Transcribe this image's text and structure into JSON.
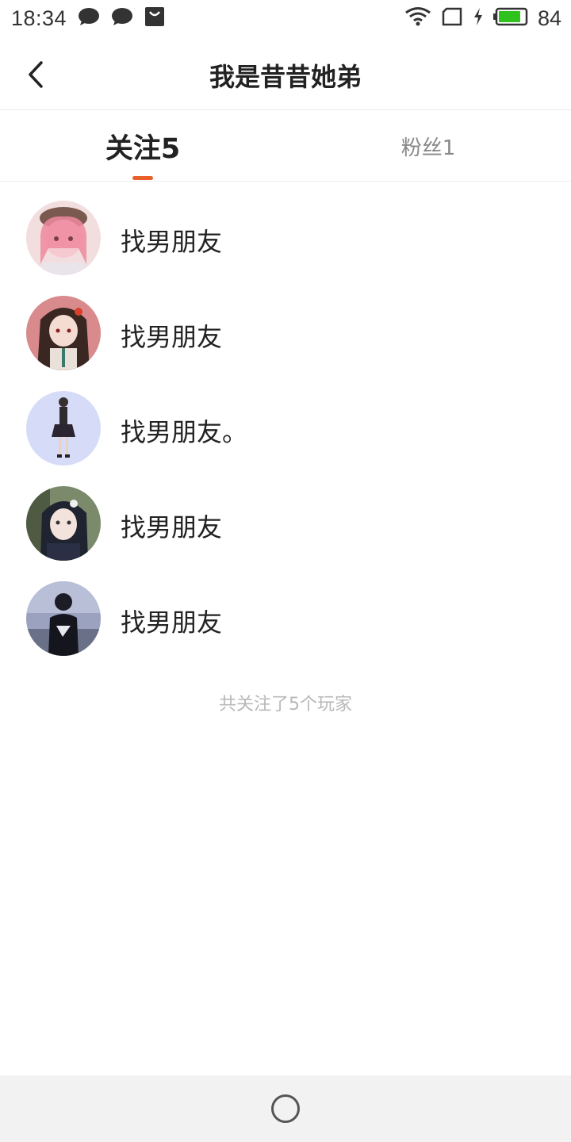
{
  "status_bar": {
    "time": "18:34",
    "battery": "84",
    "icons": [
      "chat-bubble-icon",
      "chat-bubble-icon",
      "shopping-bag-icon",
      "wifi-icon",
      "sim-card-icon",
      "charging-bolt-icon",
      "battery-icon"
    ],
    "battery_level": 0.84,
    "battery_color": "#2fc21c"
  },
  "header": {
    "title": "我是昔昔她弟",
    "back_icon": "chevron-left-icon"
  },
  "tabs": [
    {
      "label": "关注5",
      "active": true
    },
    {
      "label": "粉丝1",
      "active": false
    }
  ],
  "accent_color": "#e8612c",
  "users": [
    {
      "name": "找男朋友",
      "avatar": "pink-hair-girl-avatar"
    },
    {
      "name": "找男朋友",
      "avatar": "dark-hair-girl-avatar"
    },
    {
      "name": "找男朋友。",
      "avatar": "standing-figure-avatar"
    },
    {
      "name": "找男朋友",
      "avatar": "photo-girl-avatar"
    },
    {
      "name": "找男朋友",
      "avatar": "dark-photo-avatar"
    }
  ],
  "footer_note": "共关注了5个玩家",
  "nav": {
    "home_icon": "home-circle-icon"
  }
}
